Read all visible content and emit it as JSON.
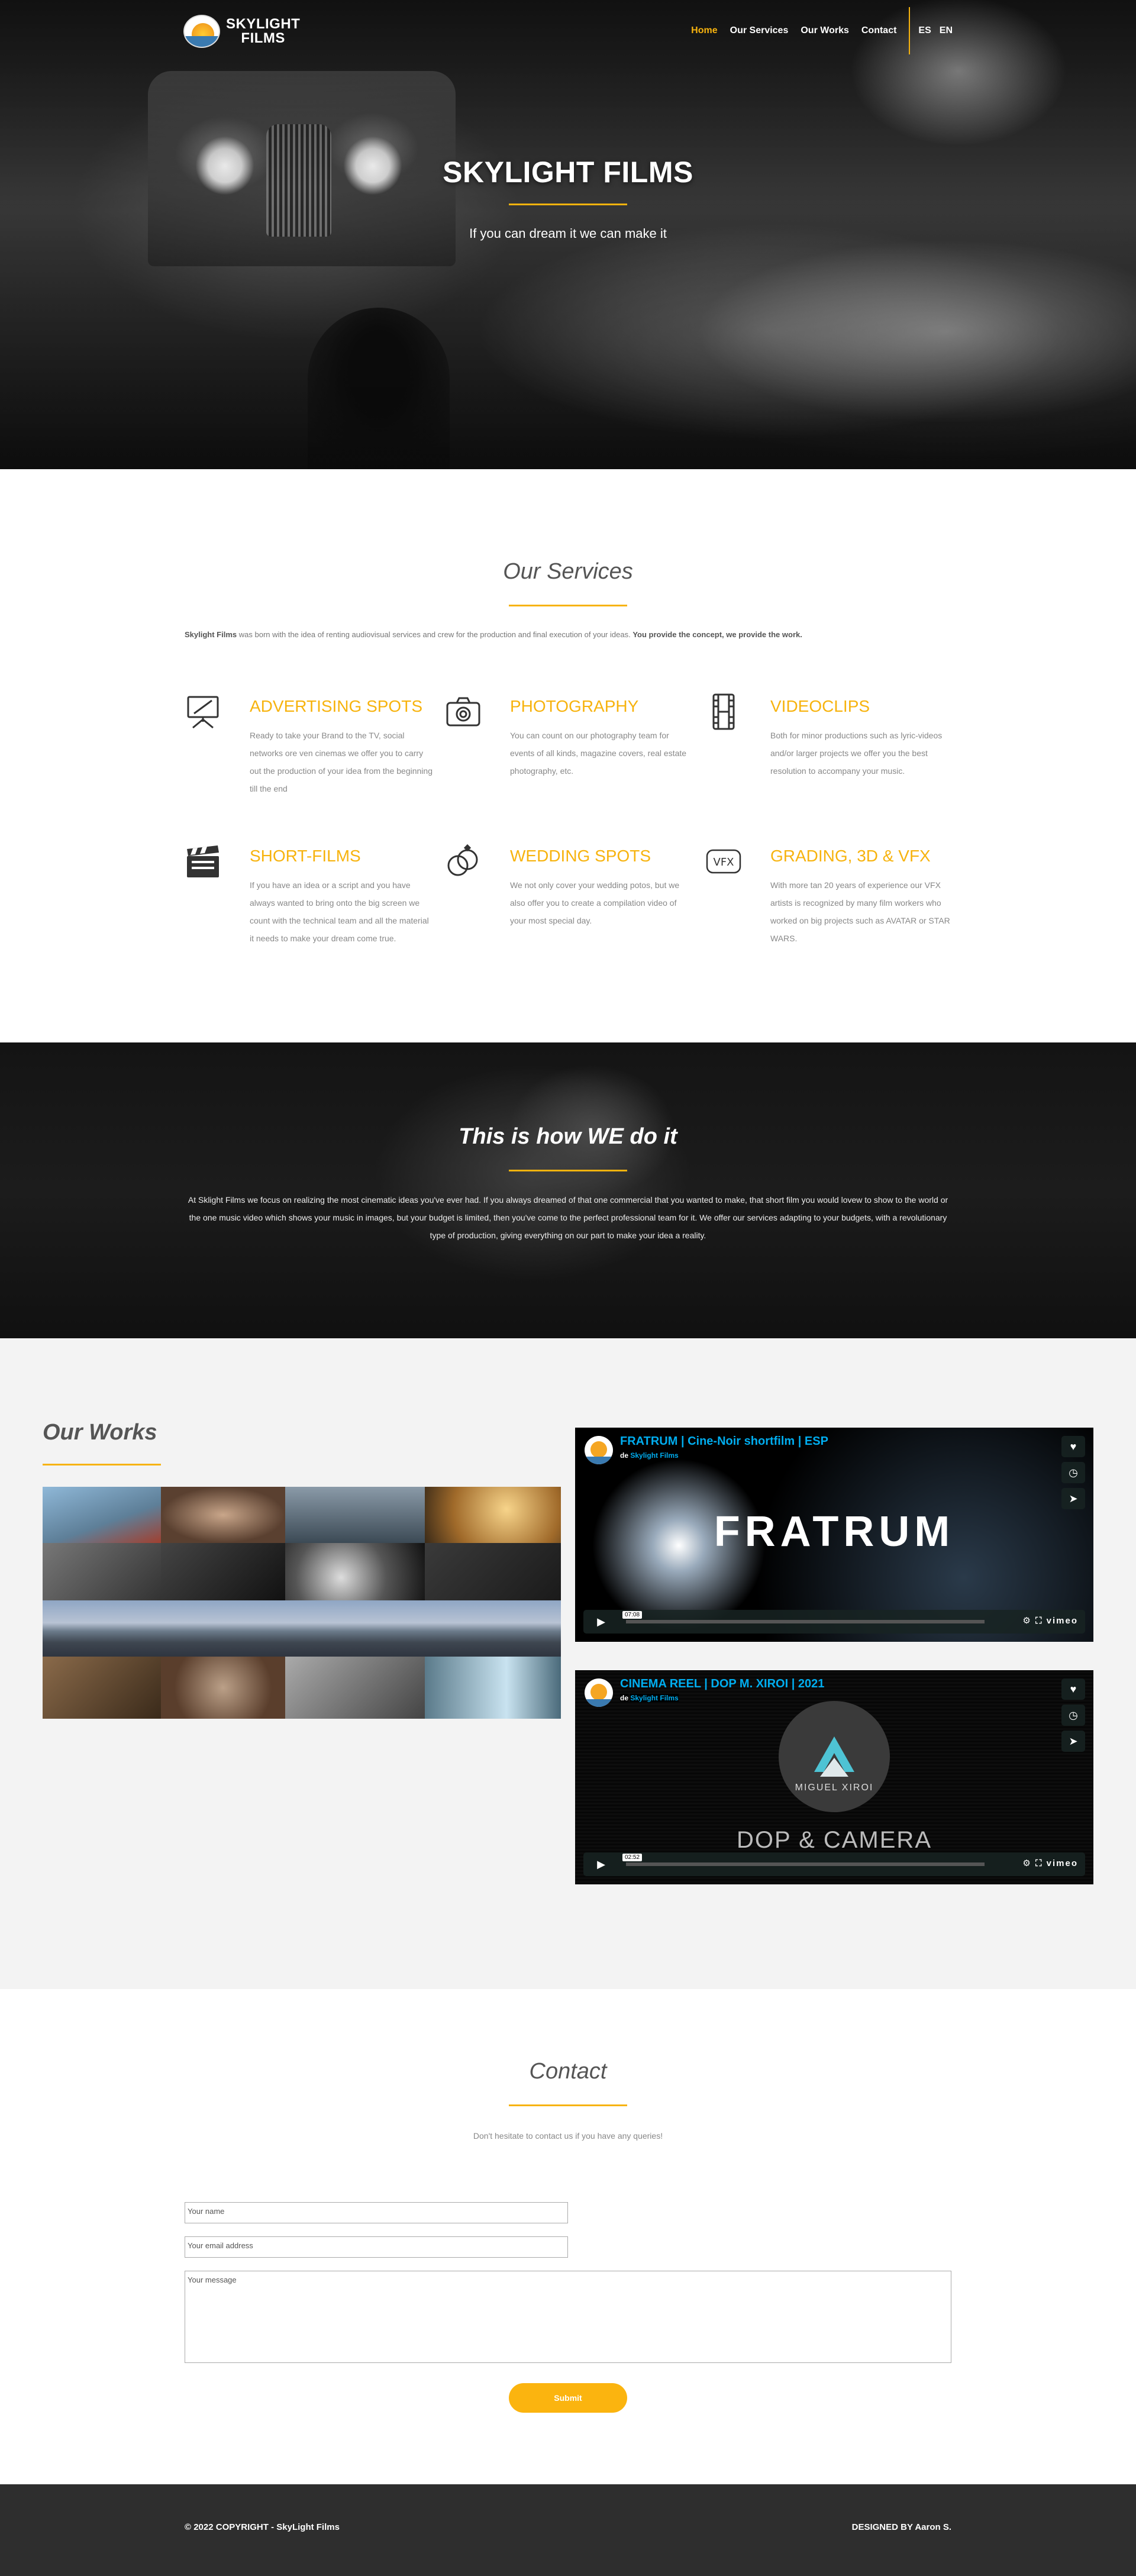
{
  "brand": {
    "line1": "SKYLIGHT",
    "line2": "FILMS"
  },
  "nav": {
    "items": [
      {
        "label": "Home",
        "active": true
      },
      {
        "label": "Our Services",
        "active": false
      },
      {
        "label": "Our Works",
        "active": false
      },
      {
        "label": "Contact",
        "active": false
      }
    ],
    "langs": [
      "ES",
      "EN"
    ]
  },
  "hero": {
    "title": "SKYLIGHT FILMS",
    "subtitle": "If you can dream it we can make it"
  },
  "services": {
    "title": "Our Services",
    "intro_brand": "Skylight Films",
    "intro_text": " was born with the idea of renting audiovisual services and crew for the production and final execution of your ideas. ",
    "intro_bold": "You provide the concept, we provide the work.",
    "items": [
      {
        "icon": "easel-icon",
        "title": "ADVERTISING SPOTS",
        "text": "Ready to take your Brand to the TV, social networks ore ven cinemas we offer you to carry out the production of your idea from the beginning till the end"
      },
      {
        "icon": "camera-icon",
        "title": "PHOTOGRAPHY",
        "text": "You can count on our photography team for events of all kinds, magazine covers, real estate photography, etc."
      },
      {
        "icon": "film-strip-icon",
        "title": "VIDEOCLIPS",
        "text": "Both for minor productions such as lyric-videos and/or larger projects we offer you the best resolution to accompany your music."
      },
      {
        "icon": "clapperboard-icon",
        "title": "SHORT-FILMS",
        "text": "If you have an idea or a script and you have always wanted to bring onto the big screen we count with the technical team and all the material it needs to make your dream come true."
      },
      {
        "icon": "rings-icon",
        "title": "WEDDING SPOTS",
        "text": "We not only cover your wedding potos, but we also offer you to create a compilation video of your most special day."
      },
      {
        "icon": "vfx-icon",
        "title": "GRADING, 3D & VFX",
        "text": "With more tan 20 years of experience our VFX artists is recognized by many film workers who worked on big projects such as AVATAR or STAR WARS."
      }
    ]
  },
  "how": {
    "title": "This is how WE do it",
    "text": "At Sklight Films we focus on realizing the most cinematic ideas you've ever had. If you always dreamed of that one commercial that you wanted to make, that short film you would lovew to show to the world or the one music video which shows your music in images, but your budget is limited, then you've come to the perfect professional team for it. We offer our services adapting to your budgets, with a revolutionary type of production, giving everything on our part to make your idea a reality."
  },
  "works": {
    "title": "Our Works",
    "videos": [
      {
        "title": "FRATRUM | Cine-Noir shortfilm | ESP",
        "by": "de",
        "channel": "Skylight Films",
        "time": "07:08",
        "poster_text": "FRATRUM",
        "brand": "vimeo"
      },
      {
        "title": "CINEMA REEL | DOP M. XIROI | 2021",
        "by": "de",
        "channel": "Skylight Films",
        "time": "02:52",
        "poster_text": "DOP & CAMERA",
        "poster_sub": "MIGUEL XIROI",
        "brand": "vimeo"
      }
    ]
  },
  "contact": {
    "title": "Contact",
    "subtitle": "Don't hesitate to contact us if you have any queries!",
    "name_placeholder": "Your name",
    "email_placeholder": "Your email address",
    "message_placeholder": "Your message",
    "submit_label": "Submit"
  },
  "footer": {
    "copyright": "© 2022 COPYRIGHT - SkyLight Films",
    "designed": "DESIGNED BY Aaron S."
  },
  "colors": {
    "accent": "#f7b30e",
    "vimeo_blue": "#00adef",
    "footer_bg": "#2e2e2e"
  }
}
